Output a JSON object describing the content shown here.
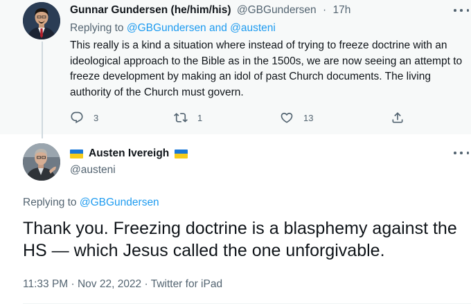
{
  "parent_tweet": {
    "author_name": "Gunnar Gundersen (he/him/his)",
    "author_handle": "@GBGundersen",
    "separator": "·",
    "time": "17h",
    "replying_prefix": "Replying to",
    "replying_to": "@GBGundersen and @austeni",
    "text": "This really is a kind a situation where instead of trying to freeze doctrine with an ideological approach to the Bible as in the 1500s, we are now seeing an attempt to freeze development by making an idol of past Church documents. The living authority of the Church must govern.",
    "stats": {
      "replies": "3",
      "retweets": "1",
      "likes": "13"
    }
  },
  "main_tweet": {
    "author_name": "Austen Ivereigh",
    "author_handle": "@austeni",
    "replying_prefix": "Replying to",
    "replying_to": "@GBGundersen",
    "text": "Thank you. Freezing doctrine is a blasphemy against the HS — which Jesus called the one unforgivable.",
    "timestamp": "11:33 PM · Nov 22, 2022",
    "meta_separator": "·",
    "source": "Twitter for iPad"
  },
  "icons": {
    "reply": "reply-icon",
    "retweet": "retweet-icon",
    "like": "heart-icon",
    "share": "share-icon",
    "more": "more-icon",
    "flag": "ukraine-flag-icon"
  },
  "colors": {
    "link": "#1d9bf0",
    "muted": "#536471",
    "text": "#0f1419",
    "parent_background": "#f7f9f9",
    "flag_blue": "#1877d6",
    "flag_yellow": "#f5cc1b"
  }
}
